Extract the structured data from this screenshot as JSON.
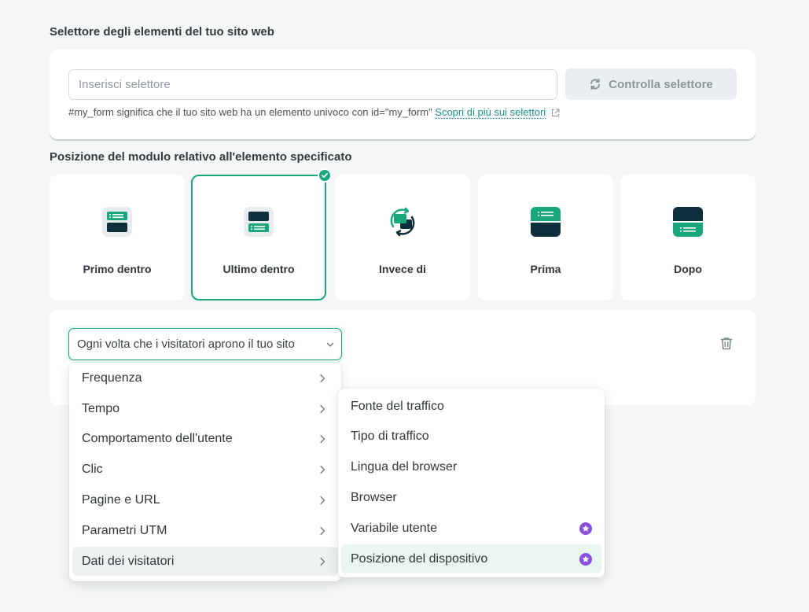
{
  "selector_section": {
    "title": "Selettore degli elementi del tuo sito web",
    "input_placeholder": "Inserisci selettore",
    "input_value": "",
    "check_button": "Controlla selettore",
    "hint_text": "#my_form significa che il tuo sito web ha un elemento univoco con id=\"my_form\"",
    "hint_link": "Scopri di più sui selettori"
  },
  "position_section": {
    "title": "Posizione del modulo relativo all'elemento specificato",
    "options": [
      {
        "label": "Primo dentro",
        "icon": "first-inside-icon",
        "selected": false
      },
      {
        "label": "Ultimo dentro",
        "icon": "last-inside-icon",
        "selected": true
      },
      {
        "label": "Invece di",
        "icon": "replace-icon",
        "selected": false
      },
      {
        "label": "Prima",
        "icon": "before-icon",
        "selected": false
      },
      {
        "label": "Dopo",
        "icon": "after-icon",
        "selected": false
      }
    ]
  },
  "rule": {
    "trigger_value": "Ogni volta che i visitatori aprono il tuo sito"
  },
  "menu_main": [
    {
      "label": "Frequenza",
      "active": false
    },
    {
      "label": "Tempo",
      "active": false
    },
    {
      "label": "Comportamento dell'utente",
      "active": false
    },
    {
      "label": "Clic",
      "active": false
    },
    {
      "label": "Pagine e URL",
      "active": false
    },
    {
      "label": "Parametri UTM",
      "active": false
    },
    {
      "label": "Dati dei visitatori",
      "active": true
    }
  ],
  "menu_sub": [
    {
      "label": "Fonte del traffico",
      "pro": false
    },
    {
      "label": "Tipo di traffico",
      "pro": false
    },
    {
      "label": "Lingua del browser",
      "pro": false
    },
    {
      "label": "Browser",
      "pro": false
    },
    {
      "label": "Variabile utente",
      "pro": true
    },
    {
      "label": "Posizione del dispositivo",
      "pro": true,
      "highlighted": true
    }
  ],
  "colors": {
    "accent": "#17a77a",
    "dark": "#0f2f3d",
    "link": "#1a8f8a",
    "pro_badge": "#8a4fe0"
  }
}
